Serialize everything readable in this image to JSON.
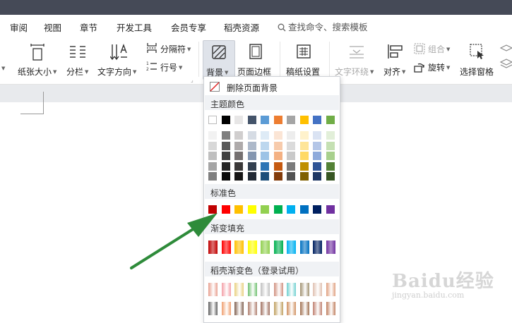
{
  "menu": {
    "items": [
      "审阅",
      "视图",
      "章节",
      "开发工具",
      "会员专享",
      "稻壳资源"
    ],
    "search_placeholder": "查找命令、搜索模板"
  },
  "ribbon": {
    "paper_size": "纸张大小",
    "columns": "分栏",
    "text_direction": "文字方向",
    "separator": "分隔符",
    "line_number": "行号",
    "background": "背景",
    "page_border": "页面边框",
    "grid_paper": "稿纸设置",
    "text_wrap": "文字环绕",
    "align": "对齐",
    "group": "组合",
    "rotate": "旋转",
    "selection_pane": "选择窗格"
  },
  "dropdown": {
    "remove_background": "删除页面背景",
    "theme_colors_label": "主题颜色",
    "standard_colors_label": "标准色",
    "gradient_fill_label": "渐变填充",
    "docer_gradient_label": "稻壳渐变色（登录试用）",
    "theme_top_row": [
      "#ffffff",
      "#000000",
      "#e7e6e6",
      "#44546a",
      "#5b9bd5",
      "#ed7d31",
      "#a5a5a5",
      "#ffc000",
      "#4472c4",
      "#70ad47"
    ],
    "theme_shades": [
      [
        "#f2f2f2",
        "#7f7f7f",
        "#d0cece",
        "#d6dce4",
        "#deebf6",
        "#fbe5d5",
        "#ededed",
        "#fff2cc",
        "#dae3f3",
        "#e2efd9"
      ],
      [
        "#d8d8d8",
        "#595959",
        "#aeaaaa",
        "#adb9ca",
        "#bdd7ee",
        "#f7cbac",
        "#dbdbdb",
        "#fee599",
        "#b4c6e7",
        "#c5e0b3"
      ],
      [
        "#bfbfbf",
        "#3f3f3f",
        "#757070",
        "#8496b0",
        "#9dc3e6",
        "#f4b183",
        "#c9c9c9",
        "#ffd965",
        "#8eaadb",
        "#a8d08d"
      ],
      [
        "#a5a5a5",
        "#262626",
        "#3a3838",
        "#323f4f",
        "#2e75b5",
        "#c55a11",
        "#7b7b7b",
        "#bf8f00",
        "#2f5496",
        "#538135"
      ],
      [
        "#7f7f7f",
        "#0c0c0c",
        "#171616",
        "#222a35",
        "#1e4e79",
        "#833c0b",
        "#525252",
        "#7f6000",
        "#1f3864",
        "#375623"
      ]
    ],
    "standard_colors": [
      "#c00000",
      "#ff0000",
      "#ffc000",
      "#ffff00",
      "#92d050",
      "#00b050",
      "#00b0f0",
      "#0070c0",
      "#002060",
      "#7030a0"
    ],
    "gradient_colors": [
      "#c00000",
      "#ff0000",
      "#ffc000",
      "#ffff00",
      "#92d050",
      "#00b050",
      "#00b0f0",
      "#0070c0",
      "#002060",
      "#7030a0"
    ],
    "docer_row1": [
      "#e8a090",
      "#f4a0a8",
      "#e8d080",
      "#70c070",
      "#c0c0c0",
      "#d09080",
      "#70d0d0",
      "#a09070",
      "#e0c0b0",
      "#e0a080"
    ],
    "docer_row2": [
      "#606060",
      "#f0a070",
      "#806050",
      "#b08070",
      "#a07060",
      "#c0a060",
      "#d09060",
      "#a07050",
      "#c08070",
      "#c08060"
    ]
  },
  "accent": {
    "arrow_color": "#2e8b3a"
  },
  "watermark": {
    "text": "Baidu经验",
    "url_text": "jingyan.baidu.com"
  }
}
